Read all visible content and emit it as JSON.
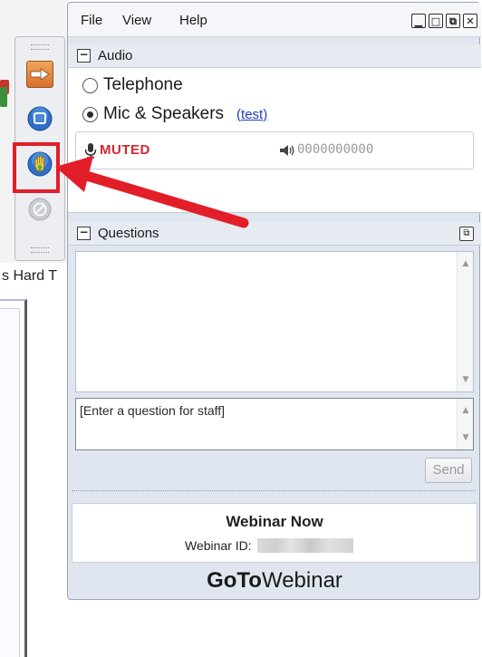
{
  "background_app": {
    "partial_label": "s Hard T"
  },
  "menu": {
    "file": "File",
    "view": "View",
    "help": "Help"
  },
  "audio": {
    "header": "Audio",
    "options": [
      "Telephone",
      "Mic & Speakers"
    ],
    "selected": "Mic & Speakers",
    "test_link": "(test)",
    "mic_status": "MUTED",
    "level_meter": "0000000000"
  },
  "questions": {
    "header": "Questions",
    "input_text": "[Enter a question for staff]",
    "send_label": "Send"
  },
  "webinar": {
    "title": "Webinar Now",
    "id_label": "Webinar ID:"
  },
  "brand": {
    "bold": "GoTo",
    "light": "Webinar"
  },
  "colors": {
    "muted_red": "#d3262f",
    "annotation_red": "#e21e28",
    "link_blue": "#1f3fbf",
    "panel_bg": "#dfe6ef"
  },
  "icons": {
    "toolbar": [
      "arrow-right-icon",
      "screen-icon",
      "raise-hand-icon",
      "disabled-icon"
    ]
  }
}
